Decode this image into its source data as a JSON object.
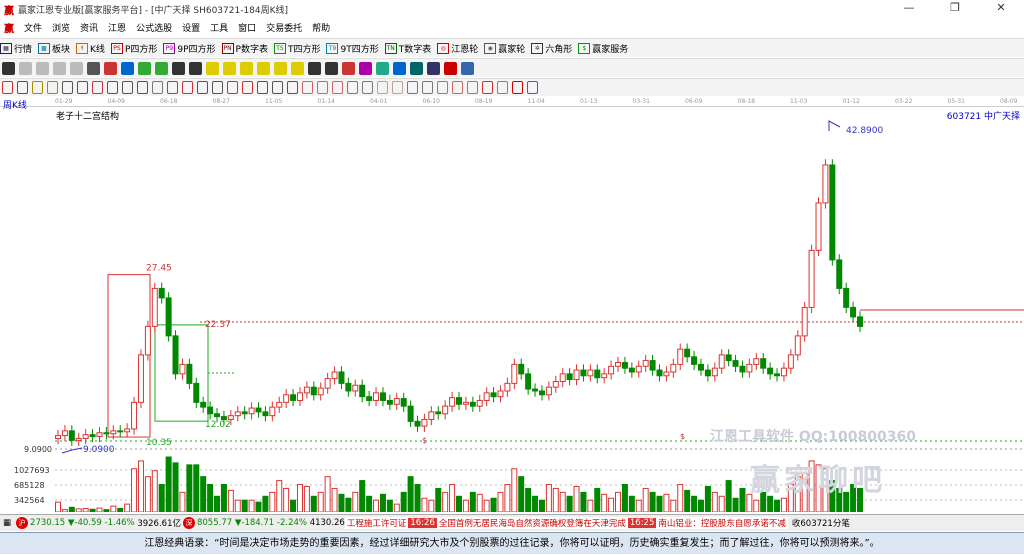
{
  "window": {
    "title": "赢家江恩专业版[赢家服务平台] - [中广天择  SH603721-184周K线]",
    "logo": "赢",
    "controls": [
      "—",
      "❐",
      "✕"
    ]
  },
  "menu": [
    "文件",
    "浏览",
    "资讯",
    "江恩",
    "公式选股",
    "设置",
    "工具",
    "窗口",
    "交易委托",
    "帮助"
  ],
  "toolbar": [
    {
      "label": "行情",
      "icon": "▦",
      "color": "#224"
    },
    {
      "label": "板块",
      "icon": "▩",
      "color": "#07a"
    },
    {
      "label": "K线",
      "icon": "↟",
      "color": "#c60"
    },
    {
      "label": "P四方形",
      "icon": "PS",
      "color": "#c00"
    },
    {
      "label": "9P四方形",
      "icon": "P9",
      "color": "#a0a"
    },
    {
      "label": "P数字表",
      "icon": "PN",
      "color": "#800"
    },
    {
      "label": "T四方形",
      "icon": "TS",
      "color": "#090"
    },
    {
      "label": "9T四方形",
      "icon": "T9",
      "color": "#08a"
    },
    {
      "label": "T数字表",
      "icon": "TN",
      "color": "#060"
    },
    {
      "label": "江恩轮",
      "icon": "◎",
      "color": "#c00"
    },
    {
      "label": "赢家轮",
      "icon": "◉",
      "color": "#555"
    },
    {
      "label": "六角形",
      "icon": "✲",
      "color": "#333"
    },
    {
      "label": "赢家服务",
      "icon": "$",
      "color": "#090"
    }
  ],
  "period": "周K线",
  "chart_title": "老子十二宫结构",
  "stock_code": "603721  中广天择",
  "time_ticks": [
    "01-29",
    "04-09",
    "06-18",
    "08-27",
    "11-05",
    "01-14",
    "04-01",
    "06-10",
    "08-19",
    "11-04",
    "01-13",
    "03-31",
    "06-09",
    "08-18",
    "11-03",
    "01-12",
    "03-22",
    "05-31",
    "08-09"
  ],
  "price_axis": {
    "min_label": "9.0900"
  },
  "annotations": {
    "high": "42.8900",
    "low": "9.0900",
    "box_top": "27.45",
    "box_bottom": "10.35",
    "box2_top": "22.37",
    "box2_bottom": "12.02",
    "marker": "$"
  },
  "volume_axis": [
    "1027693",
    "685128",
    "342564"
  ],
  "watermark": {
    "text1": "江恩工具软件  QQ:100800360",
    "text2": "赢家聊吧"
  },
  "chart_data": {
    "type": "candlestick",
    "price_range": [
      9.09,
      42.89
    ],
    "closes": [
      10.5,
      11,
      10,
      10.2,
      10.6,
      10.4,
      10.8,
      10.7,
      11,
      10.9,
      11.2,
      14,
      19,
      22,
      26,
      25,
      21,
      17,
      18,
      16,
      14,
      13.5,
      12.8,
      12.5,
      12.2,
      12.6,
      13,
      12.8,
      13.4,
      13,
      12.6,
      13.5,
      14,
      14.8,
      14.2,
      15,
      15.6,
      14.8,
      15.5,
      16.5,
      17.2,
      16,
      15.2,
      15.8,
      14.6,
      14.2,
      15,
      14.2,
      13.8,
      14.4,
      13.6,
      12,
      11.5,
      12.2,
      13,
      12.8,
      13.6,
      14.5,
      13.8,
      14,
      13.6,
      14.2,
      15,
      14.6,
      15.2,
      16,
      18,
      17,
      15.4,
      15.2,
      14.8,
      15.6,
      16.2,
      17,
      16.4,
      17.4,
      16.8,
      17.4,
      16.6,
      17,
      17.8,
      18.2,
      17.6,
      17.2,
      17.8,
      18.4,
      17.4,
      16.8,
      17.2,
      18,
      19.6,
      18.8,
      18,
      17.4,
      16.8,
      17.6,
      19,
      18.4,
      17.8,
      17.2,
      18,
      18.6,
      17.6,
      17,
      16.8,
      17.6,
      19,
      21,
      24,
      30,
      35,
      39,
      29,
      26,
      24,
      23,
      22
    ],
    "volumes": [
      250,
      60,
      120,
      80,
      90,
      70,
      100,
      60,
      150,
      90,
      200,
      1100,
      1300,
      900,
      1050,
      700,
      1400,
      1250,
      500,
      1200,
      1200,
      900,
      700,
      400,
      700,
      550,
      300,
      300,
      300,
      250,
      400,
      500,
      800,
      600,
      300,
      700,
      650,
      400,
      500,
      900,
      600,
      450,
      350,
      500,
      800,
      400,
      300,
      450,
      300,
      200,
      500,
      900,
      700,
      350,
      300,
      600,
      500,
      700,
      400,
      300,
      500,
      450,
      300,
      350,
      500,
      700,
      1100,
      900,
      600,
      400,
      300,
      700,
      600,
      500,
      400,
      650,
      500,
      300,
      600,
      450,
      350,
      500,
      700,
      400,
      300,
      600,
      500,
      400,
      450,
      300,
      700,
      550,
      400,
      300,
      650,
      500,
      400,
      800,
      350,
      600,
      450,
      300,
      500,
      400,
      300,
      350,
      700,
      900,
      1000,
      1300,
      1200,
      1100,
      800,
      600,
      500,
      700,
      600
    ]
  },
  "status": {
    "sh_index": "2730.15",
    "sh_change": "▼-40.59",
    "sh_pct": "-1.46%",
    "sh_amount": "3926.61亿",
    "sz_index": "8055.77",
    "sz_change": "▼-184.71",
    "sz_pct": "-2.24%",
    "sz_amount": "4130.26",
    "news1": "工程施工许可证",
    "time1": "16:26",
    "news2": "全国首例无居民海岛自然资源确权登簿在天津完成",
    "time2": "16:25",
    "news3": "南山铝业：控股股东自愿承诺不减",
    "recv": "收603721分笔",
    "sh_badge": "沪",
    "sz_badge": "深"
  },
  "quote": "江恩经典语录：“时间是决定市场走势的重要因素，经过详细研究大市及个别股票的过往记录，你将可以证明，历史确实重复发生；而了解过往，你将可以预测将来。”。"
}
